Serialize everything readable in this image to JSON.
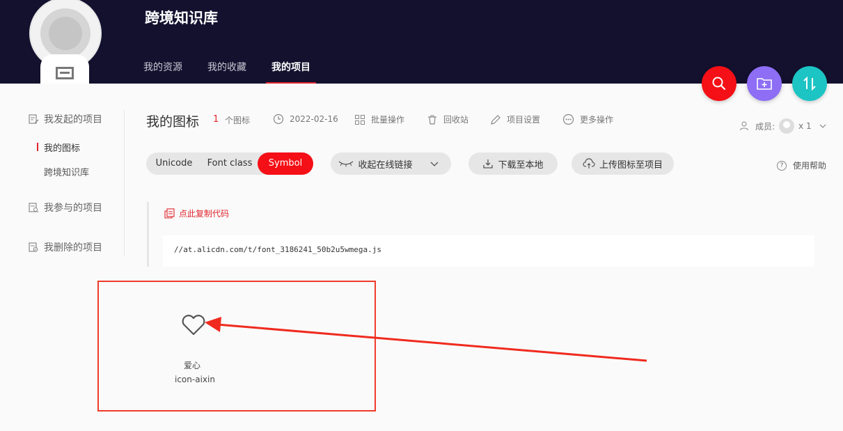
{
  "header": {
    "project_title": "跨境知识库",
    "tabs": [
      {
        "label": "我的资源"
      },
      {
        "label": "我的收藏"
      },
      {
        "label": "我的项目"
      }
    ]
  },
  "sidebar": {
    "initiated": "我发起的项目",
    "sub_items": [
      {
        "label": "我的图标"
      },
      {
        "label": "跨境知识库"
      }
    ],
    "participated": "我参与的项目",
    "deleted": "我删除的项目"
  },
  "toolbar": {
    "page_title": "我的图标",
    "icon_count": "1",
    "icon_count_label": "个图标",
    "date": "2022-02-16",
    "batch": "批量操作",
    "recycle": "回收站",
    "settings": "项目设置",
    "more": "更多操作",
    "members_label": "成员:",
    "members_count": "x 1"
  },
  "tabs": {
    "unicode": "Unicode",
    "font_class": "Font class",
    "symbol": "Symbol"
  },
  "actions": {
    "collapse_link": "收起在线链接",
    "download": "下载至本地",
    "upload": "上传图标至项目",
    "help": "使用帮助"
  },
  "code": {
    "copy_label": "点此复制代码",
    "url": "//at.alicdn.com/t/font_3186241_50b2u5wmega.js"
  },
  "icon": {
    "name": "爱心",
    "class": "icon-aixin",
    "glyph": "heart-icon"
  },
  "colors": {
    "header_bg": "#13112e",
    "accent_red": "#f50f16",
    "purple": "#8d6ef5",
    "teal": "#1cc4c4"
  }
}
